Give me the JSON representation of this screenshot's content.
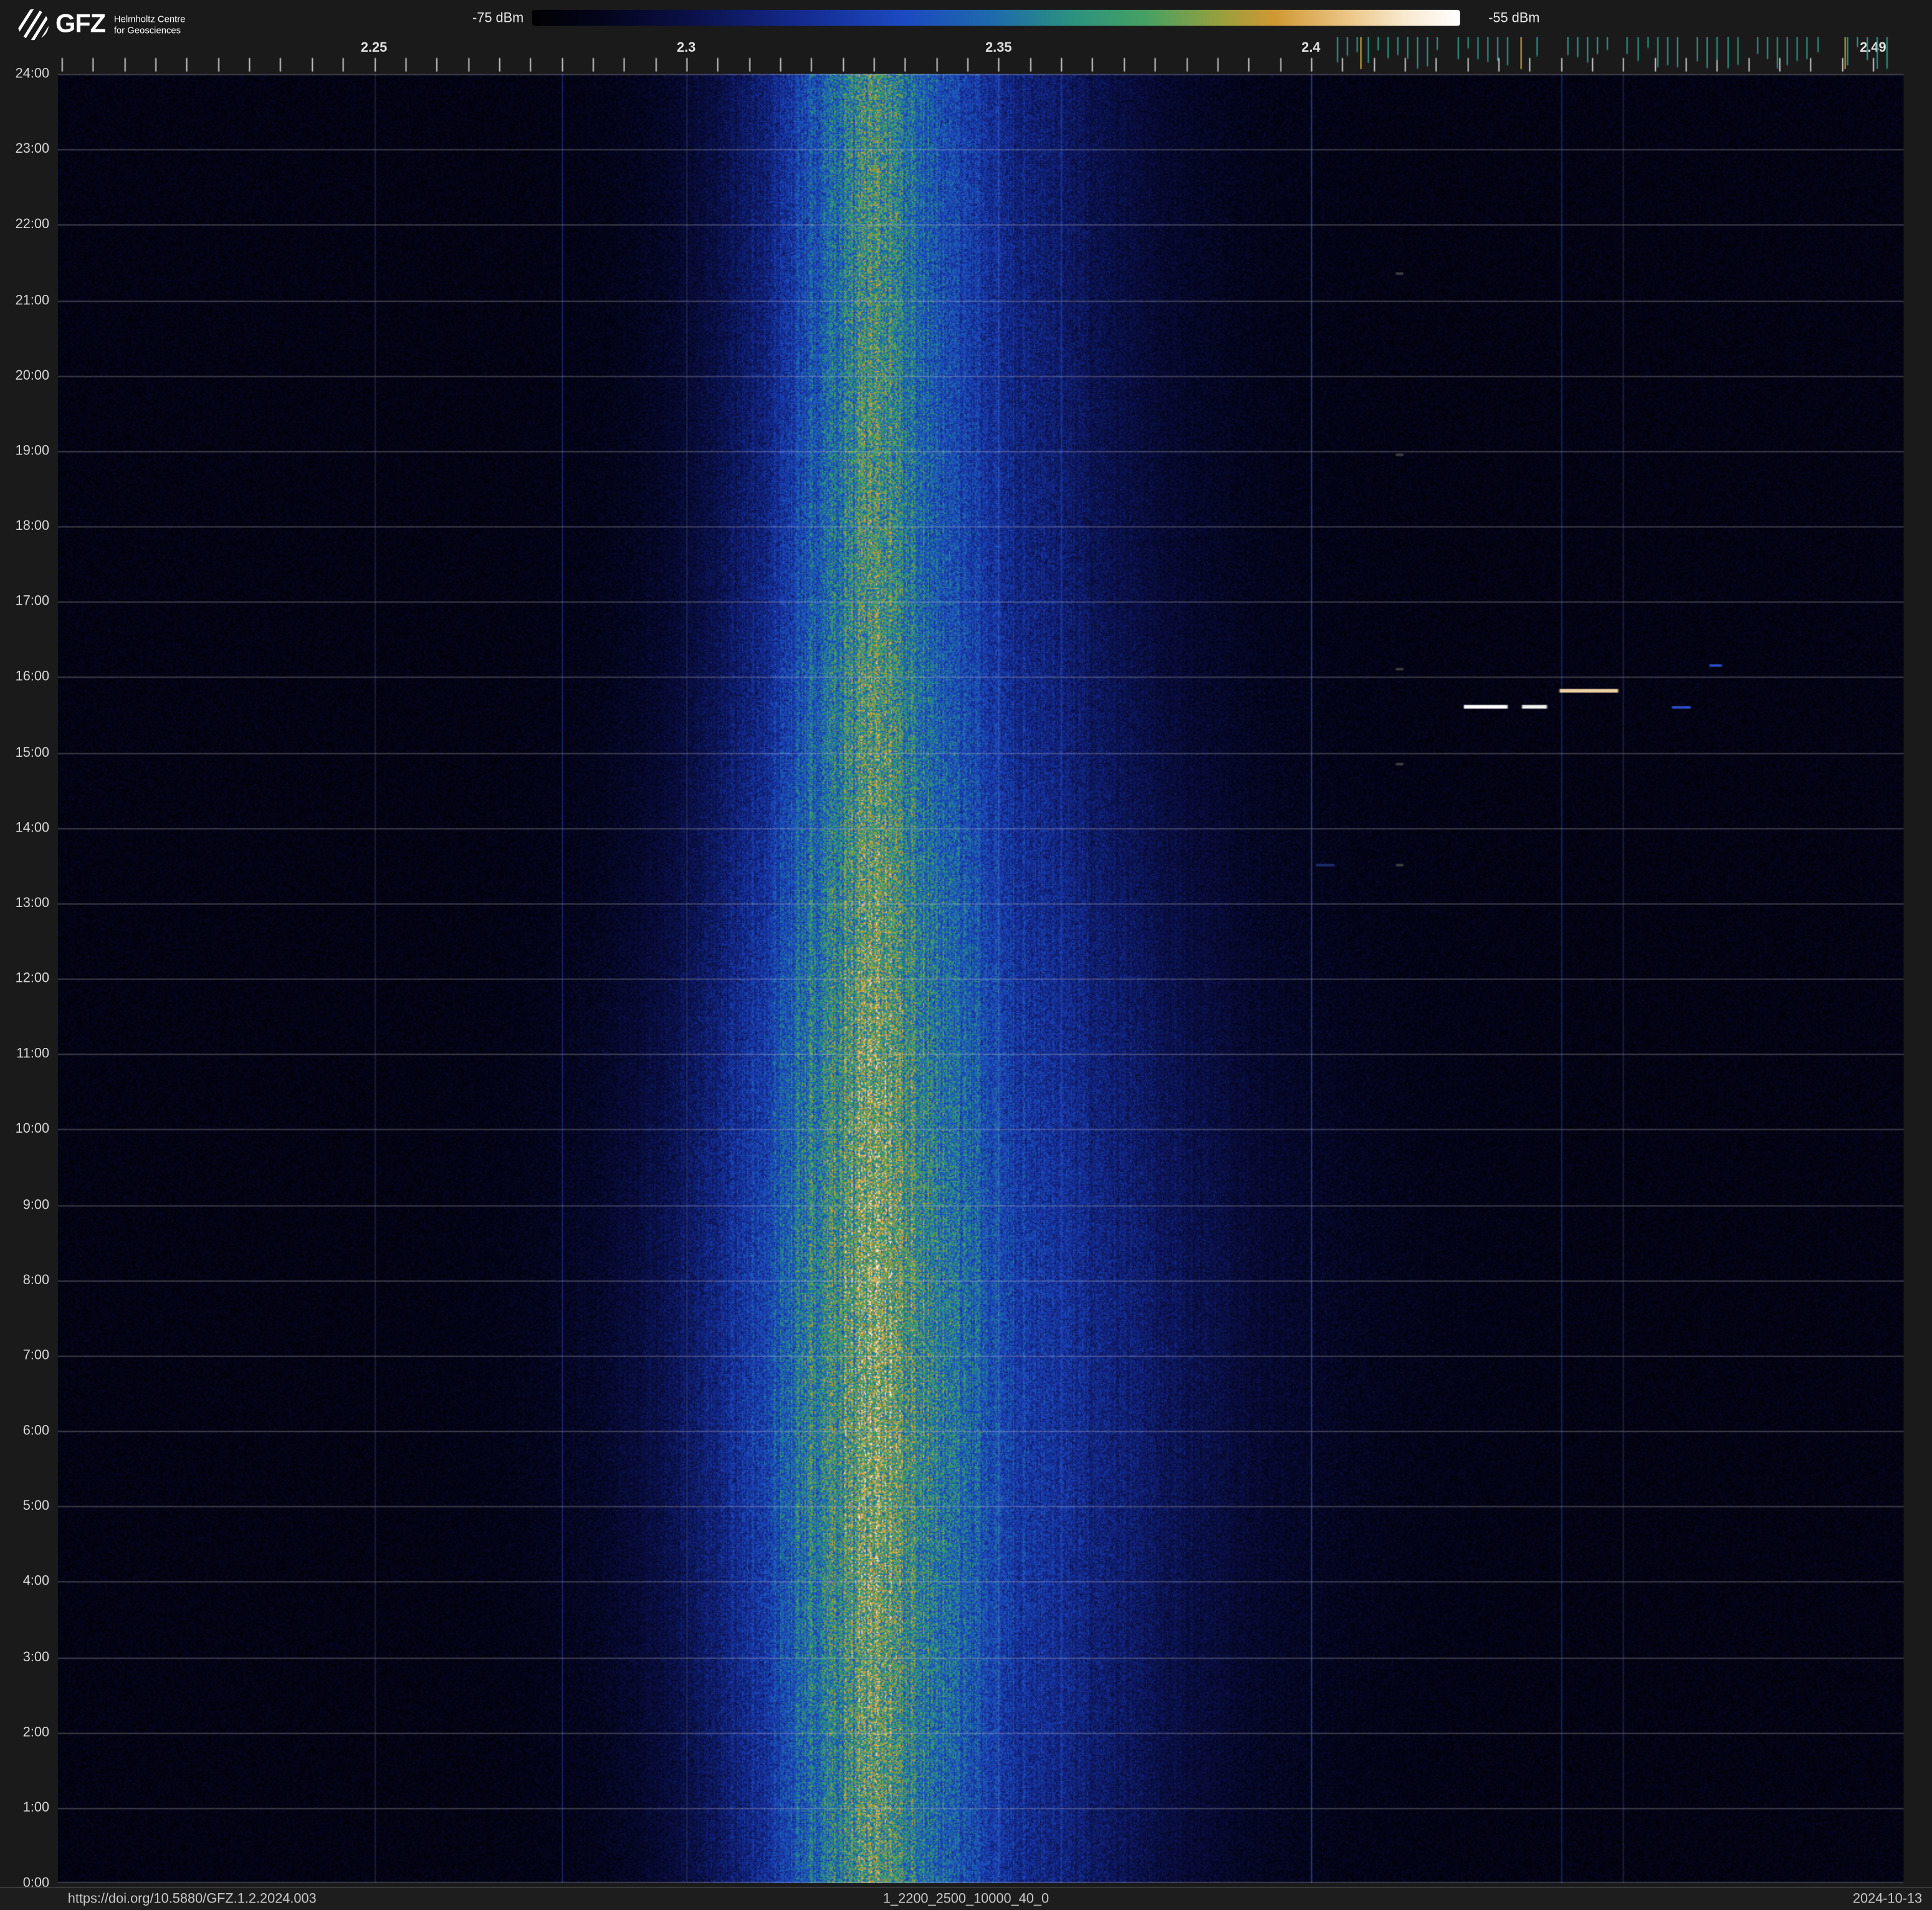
{
  "header": {
    "logo": {
      "brand": "GFZ",
      "line1": "Helmholtz Centre",
      "line2": "for Geosciences"
    },
    "colorbar": {
      "min_label": "-75 dBm",
      "max_label": "-55 dBm"
    }
  },
  "footer": {
    "doi": "https://doi.org/10.5880/GFZ.1.2.2024.003",
    "dataset_id": "1_2200_2500_10000_40_0",
    "date": "2024-10-13"
  },
  "chart_data": {
    "type": "heatmap",
    "description": "24-hour radio spectrogram, frequency 2.2-2.495 MHz vs time of day, power -75 to -55 dBm. Broad emission band centered near 2.33 MHz with blue halo and green core, persisting all day, widest around 06:00-12:00. Sporadic narrowband transmissions near 2.40-2.47 MHz around 13:30-16:10.",
    "x_axis": {
      "unit": "MHz",
      "range": [
        2.1994,
        2.4949
      ],
      "ticks": [
        {
          "value": 2.25,
          "label": "2.25"
        },
        {
          "value": 2.3,
          "label": "2.3"
        },
        {
          "value": 2.35,
          "label": "2.35"
        },
        {
          "value": 2.4,
          "label": "2.4"
        },
        {
          "value": 2.49,
          "label": "2.49"
        }
      ],
      "gridlines_mhz": [
        2.25,
        2.3,
        2.35,
        2.4,
        2.45
      ]
    },
    "y_axis": {
      "unit": "time of day",
      "range_hours": [
        0,
        24
      ],
      "tick_labels": [
        "24:00",
        "23:00",
        "22:00",
        "21:00",
        "20:00",
        "19:00",
        "18:00",
        "17:00",
        "16:00",
        "15:00",
        "14:00",
        "13:00",
        "12:00",
        "11:00",
        "10:00",
        "9:00",
        "8:00",
        "7:00",
        "6:00",
        "5:00",
        "4:00",
        "3:00",
        "2:00",
        "1:00",
        "0:00"
      ]
    },
    "colorbar": {
      "min_dbm": -75,
      "max_dbm": -55,
      "stops": [
        [
          0.0,
          "#010103"
        ],
        [
          0.08,
          "#04051e"
        ],
        [
          0.17,
          "#0a1048"
        ],
        [
          0.28,
          "#13288a"
        ],
        [
          0.4,
          "#1c49c1"
        ],
        [
          0.5,
          "#1e6cab"
        ],
        [
          0.58,
          "#2b9180"
        ],
        [
          0.66,
          "#45a163"
        ],
        [
          0.74,
          "#96a03e"
        ],
        [
          0.8,
          "#cf9833"
        ],
        [
          0.88,
          "#ecc687"
        ],
        [
          0.94,
          "#f8e9cf"
        ],
        [
          1.0,
          "#ffffff"
        ]
      ]
    },
    "band": {
      "center_mhz": 2.33,
      "core_center_mhz": 2.3295,
      "sigma_left": 0.017,
      "sigma_right": 0.026,
      "core_sigma": 0.0076,
      "halo_amp": 0.38,
      "core_amp": 0.26,
      "noise_floor": 0.045,
      "peak_hour": 7.5,
      "amp_boost": 0.18,
      "width_boost": 0.35
    },
    "carrier_lines_mhz": [
      2.28,
      2.36,
      2.4,
      2.44
    ],
    "minor_tick_step_mhz": 0.005,
    "channel_ticks": {
      "start_mhz": 2.401,
      "end_mhz": 2.4935,
      "step_mhz": 0.0016,
      "color": "#2fa08f"
    },
    "highlight_ticks_mhz": [
      2.408,
      2.4335,
      2.4855
    ],
    "events": [
      {
        "freq_start_mhz": 2.4245,
        "freq_end_mhz": 2.4315,
        "time_hours": 15.62,
        "color": "#ffffff",
        "height": 3
      },
      {
        "freq_start_mhz": 2.4338,
        "freq_end_mhz": 2.4378,
        "time_hours": 15.62,
        "color": "#eeeeee",
        "height": 3
      },
      {
        "freq_start_mhz": 2.4398,
        "freq_end_mhz": 2.4492,
        "time_hours": 15.82,
        "color": "#eccfa2",
        "height": 3
      },
      {
        "freq_start_mhz": 2.4578,
        "freq_end_mhz": 2.4608,
        "time_hours": 15.6,
        "color": "#2b4fd0",
        "height": 2
      },
      {
        "freq_start_mhz": 2.4638,
        "freq_end_mhz": 2.4658,
        "time_hours": 16.15,
        "color": "#2b4fd0",
        "height": 2
      },
      {
        "freq_start_mhz": 2.4008,
        "freq_end_mhz": 2.4038,
        "time_hours": 13.5,
        "color": "#1c2c6a",
        "height": 2
      },
      {
        "freq_start_mhz": 2.4136,
        "freq_end_mhz": 2.4148,
        "time_hours": 21.35,
        "color": "#3c3c46",
        "height": 2
      },
      {
        "freq_start_mhz": 2.4136,
        "freq_end_mhz": 2.4148,
        "time_hours": 18.95,
        "color": "#3c3c46",
        "height": 2
      },
      {
        "freq_start_mhz": 2.4136,
        "freq_end_mhz": 2.4148,
        "time_hours": 16.1,
        "color": "#3c3c46",
        "height": 2
      },
      {
        "freq_start_mhz": 2.4136,
        "freq_end_mhz": 2.4148,
        "time_hours": 14.85,
        "color": "#3c3c46",
        "height": 2
      },
      {
        "freq_start_mhz": 2.4136,
        "freq_end_mhz": 2.4148,
        "time_hours": 13.5,
        "color": "#3c3c46",
        "height": 2
      }
    ]
  }
}
